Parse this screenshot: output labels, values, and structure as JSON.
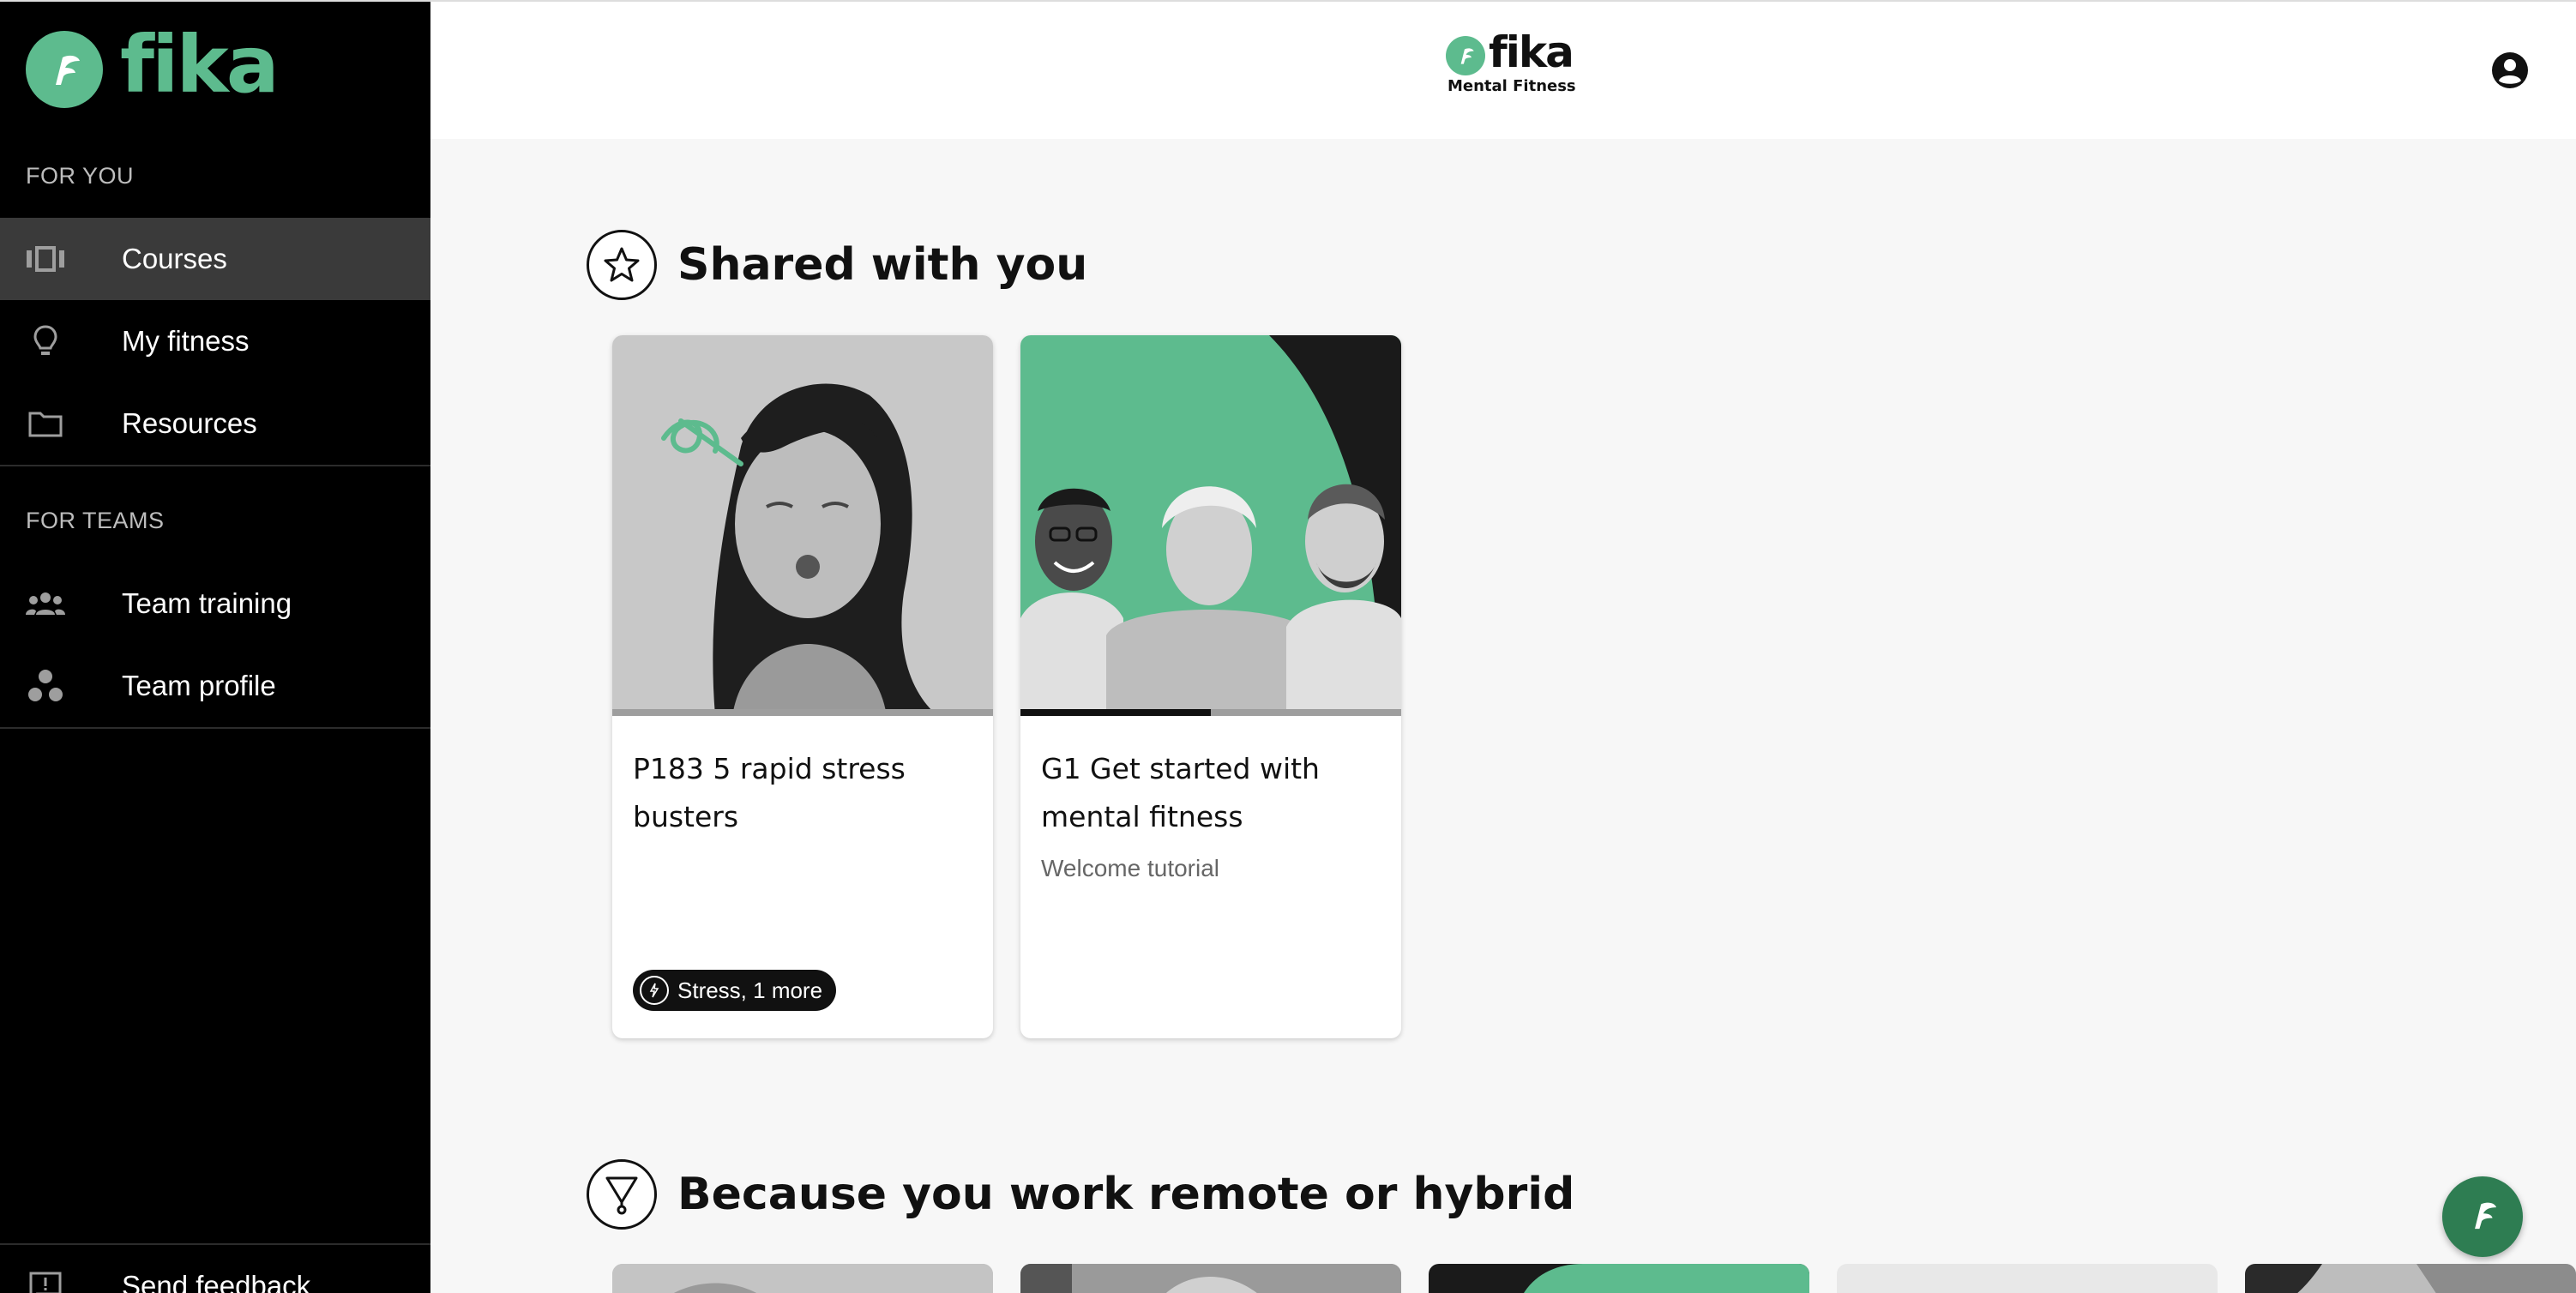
{
  "brand": {
    "name": "fika",
    "subtitle": "Mental Fitness",
    "accent": "#5dbb8e"
  },
  "sidebar": {
    "sections": [
      {
        "label": "FOR YOU"
      },
      {
        "label": "FOR TEAMS"
      }
    ],
    "items": [
      {
        "label": "Courses",
        "icon": "courses-icon",
        "active": true
      },
      {
        "label": "My fitness",
        "icon": "lightbulb-icon"
      },
      {
        "label": "Resources",
        "icon": "folder-icon"
      },
      {
        "label": "Team training",
        "icon": "group-icon"
      },
      {
        "label": "Team profile",
        "icon": "circles-icon"
      }
    ],
    "feedback": {
      "label": "Send feedback",
      "icon": "feedback-icon"
    }
  },
  "header": {
    "account_icon": "account-icon"
  },
  "sections": [
    {
      "title": "Shared with you",
      "icon": "star-icon",
      "cards": [
        {
          "title": "P183 5 rapid stress busters",
          "tag": "Stress, 1 more",
          "progress": 0
        },
        {
          "title": "G1 Get started with mental fitness",
          "subtitle": "Welcome tutorial",
          "progress": 0.5
        }
      ]
    },
    {
      "title": "Because you work remote or hybrid",
      "icon": "filter-icon"
    }
  ],
  "fab": {
    "icon": "fika-chat-icon"
  }
}
